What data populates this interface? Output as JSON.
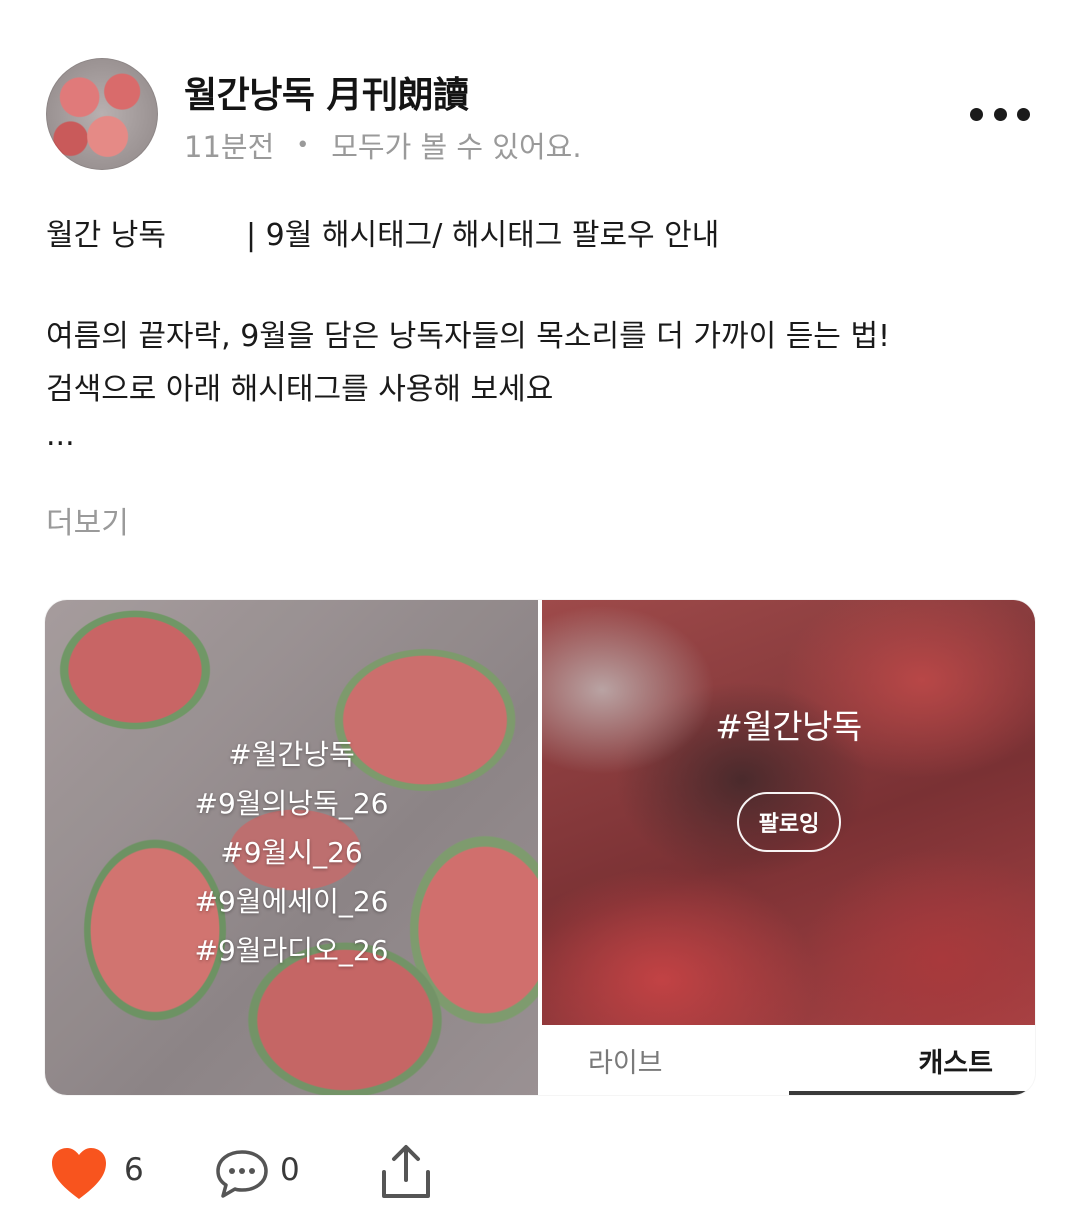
{
  "post": {
    "channel_name": "월간낭독 月刊朗讀",
    "time_ago": "11분전",
    "dot": "•",
    "visibility": "모두가 볼 수 있어요.",
    "title_left": "월간 낭독",
    "title_right": "| 9월 해시태그/ 해시태그 팔로우 안내",
    "body_line1": "여름의 끝자락, 9월을 담은 낭독자들의 목소리를 더 가까이 듣는 법!",
    "body_line2": "검색으로 아래 해시태그를 사용해 보세요",
    "ellipsis": "...",
    "read_more": "더보기"
  },
  "media": {
    "tags": [
      "#월간낭독",
      "#9월의낭독_26",
      "#9월시_26",
      "#9월에세이_26",
      "#9월라디오_26"
    ],
    "cast_title": "#월간낭독",
    "follow_label": "팔로잉",
    "tabs": [
      {
        "label": "라이브",
        "selected": false
      },
      {
        "label": "캐스트",
        "selected": true
      }
    ]
  },
  "actions": {
    "like_count": "6",
    "comment_count": "0"
  },
  "colors": {
    "heart": "#F8541E",
    "muted_text": "#9A9A9A"
  },
  "icons": {
    "more": "more-dots-icon",
    "like": "heart-icon",
    "comment": "comment-bubble-icon",
    "share": "share-icon"
  }
}
